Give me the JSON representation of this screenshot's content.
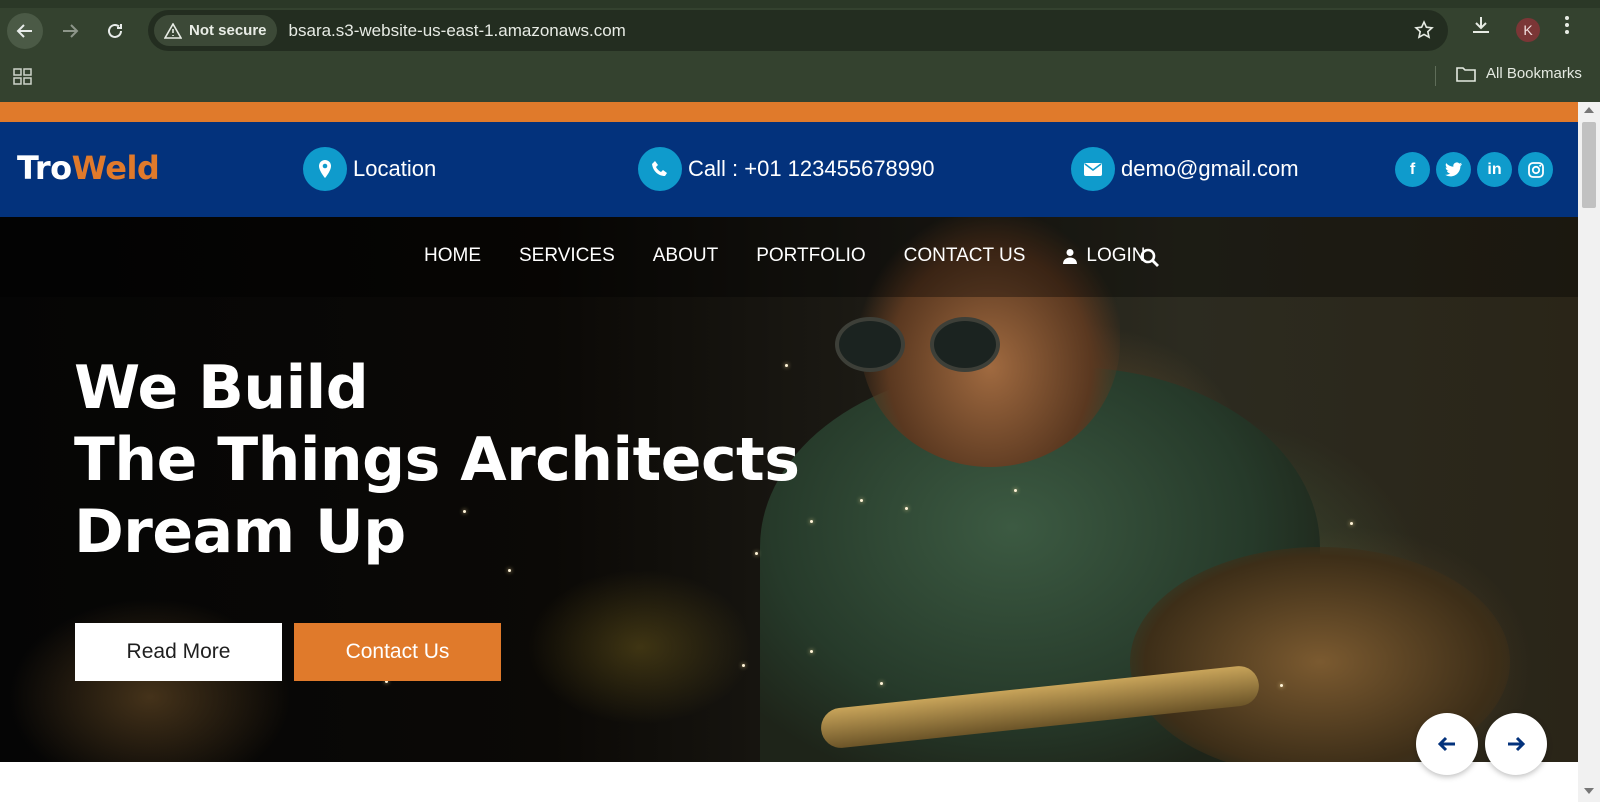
{
  "browser": {
    "security_label": "Not secure",
    "url": "bsara.s3-website-us-east-1.amazonaws.com",
    "profile_initial": "K",
    "bookmarks_label": "All Bookmarks",
    "icons": [
      "back-icon",
      "forward-icon",
      "reload-icon",
      "warning-icon",
      "star-icon",
      "download-icon",
      "more-icon",
      "apps-icon",
      "folder-icon"
    ]
  },
  "site": {
    "logo_part1": "Tro",
    "logo_part2": "Weld",
    "topbar": {
      "location": "Location",
      "phone": "Call : +01 123455678990",
      "email": "demo@gmail.com"
    },
    "social": [
      {
        "icon": "facebook-icon",
        "glyph": "f"
      },
      {
        "icon": "twitter-icon",
        "glyph": "t"
      },
      {
        "icon": "linkedin-icon",
        "glyph": "in"
      },
      {
        "icon": "instagram-icon",
        "glyph": "ig"
      }
    ],
    "menu": {
      "home": "HOME",
      "services": "SERVICES",
      "about": "ABOUT",
      "portfolio": "PORTFOLIO",
      "contact": "CONTACT US",
      "login": "LOGIN"
    },
    "hero": {
      "line1": "We Build",
      "line2": "The Things Architects",
      "line3": "Dream Up",
      "read_more": "Read More",
      "contact_us": "Contact Us"
    }
  },
  "colors": {
    "orange": "#e07a2b",
    "navy": "#03327c",
    "cyan": "#0f9bcc",
    "chrome": "#34422f"
  }
}
